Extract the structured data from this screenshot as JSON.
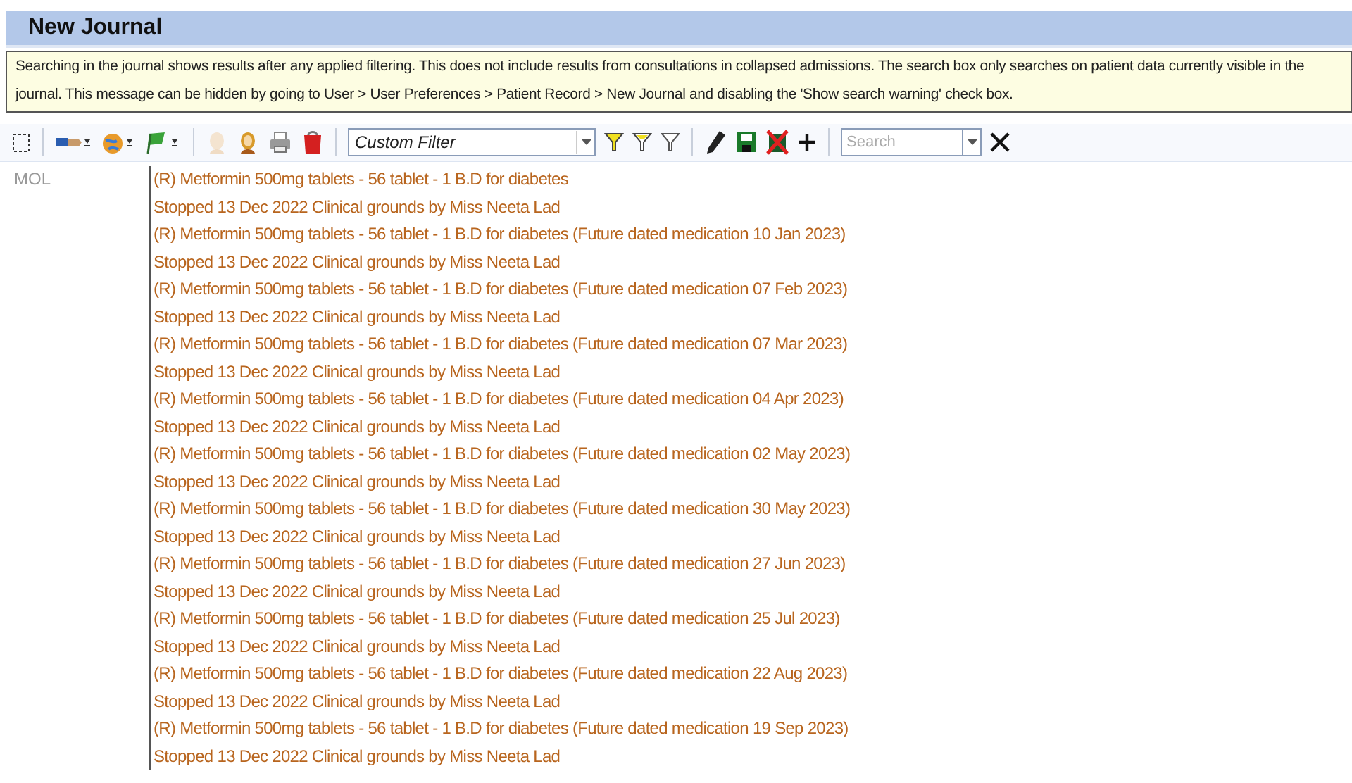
{
  "title": "New Journal",
  "warning": "Searching in the journal shows results after any applied filtering. This does not include results from consultations in collapsed admissions. The search box only searches on patient data currently visible in the journal. This message can be hidden by going to User > User Preferences > Patient Record > New Journal and disabling the 'Show search warning' check box.",
  "filter": {
    "value": "Custom Filter"
  },
  "search": {
    "placeholder": "Search"
  },
  "journal": {
    "section": "MOL",
    "lines": [
      "(R) Metformin 500mg tablets - 56 tablet - 1 B.D for diabetes",
      "Stopped 13 Dec 2022 Clinical grounds by Miss Neeta Lad",
      "(R) Metformin 500mg tablets - 56 tablet - 1 B.D for diabetes (Future dated medication 10 Jan 2023)",
      "Stopped 13 Dec 2022 Clinical grounds by Miss Neeta Lad",
      "(R) Metformin 500mg tablets - 56 tablet - 1 B.D for diabetes (Future dated medication 07 Feb 2023)",
      "Stopped 13 Dec 2022 Clinical grounds by Miss Neeta Lad",
      "(R) Metformin 500mg tablets - 56 tablet - 1 B.D for diabetes (Future dated medication 07 Mar 2023)",
      "Stopped 13 Dec 2022 Clinical grounds by Miss Neeta Lad",
      "(R) Metformin 500mg tablets - 56 tablet - 1 B.D for diabetes (Future dated medication 04 Apr 2023)",
      "Stopped 13 Dec 2022 Clinical grounds by Miss Neeta Lad",
      "(R) Metformin 500mg tablets - 56 tablet - 1 B.D for diabetes (Future dated medication 02 May 2023)",
      "Stopped 13 Dec 2022 Clinical grounds by Miss Neeta Lad",
      "(R) Metformin 500mg tablets - 56 tablet - 1 B.D for diabetes (Future dated medication 30 May 2023)",
      "Stopped 13 Dec 2022 Clinical grounds by Miss Neeta Lad",
      "(R) Metformin 500mg tablets - 56 tablet - 1 B.D for diabetes (Future dated medication 27 Jun 2023)",
      "Stopped 13 Dec 2022 Clinical grounds by Miss Neeta Lad",
      "(R) Metformin 500mg tablets - 56 tablet - 1 B.D for diabetes (Future dated medication 25 Jul 2023)",
      "Stopped 13 Dec 2022 Clinical grounds by Miss Neeta Lad",
      "(R) Metformin 500mg tablets - 56 tablet - 1 B.D for diabetes (Future dated medication 22 Aug 2023)",
      "Stopped 13 Dec 2022 Clinical grounds by Miss Neeta Lad",
      "(R) Metformin 500mg tablets - 56 tablet - 1 B.D for diabetes (Future dated medication 19 Sep 2023)",
      "Stopped 13 Dec 2022 Clinical grounds by Miss Neeta Lad"
    ]
  }
}
